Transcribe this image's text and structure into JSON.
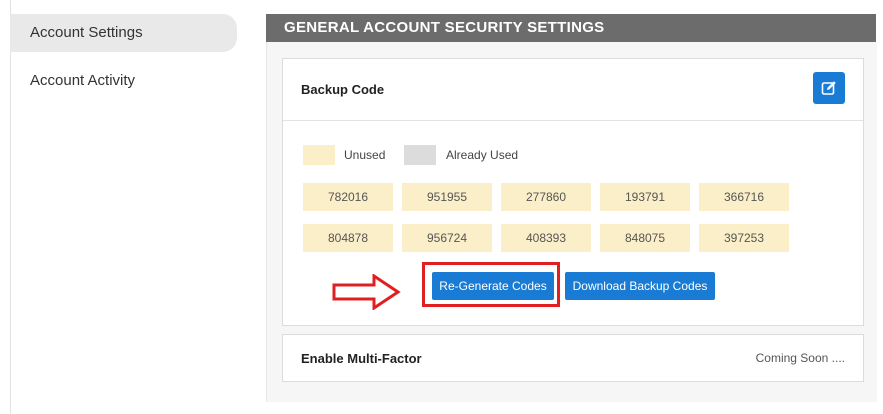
{
  "sidebar": {
    "items": [
      {
        "label": "Account Settings",
        "active": true
      },
      {
        "label": "Account Activity",
        "active": false
      }
    ]
  },
  "section": {
    "title": "GENERAL ACCOUNT SECURITY SETTINGS"
  },
  "backup_code": {
    "title": "Backup Code",
    "edit_icon": "edit-icon",
    "legend": {
      "unused_label": "Unused",
      "used_label": "Already Used",
      "unused_color": "#fbefc9",
      "used_color": "#dcdcdc"
    },
    "codes": [
      [
        "782016",
        "951955",
        "277860",
        "193791",
        "366716"
      ],
      [
        "804878",
        "956724",
        "408393",
        "848075",
        "397253"
      ]
    ],
    "regenerate_label": "Re-Generate Codes",
    "download_label": "Download Backup Codes"
  },
  "multi_factor": {
    "title": "Enable Multi-Factor",
    "status": "Coming Soon ...."
  },
  "colors": {
    "accent": "#1a7bd4",
    "highlight": "#e02020",
    "header_bg": "#6c6c6c"
  }
}
